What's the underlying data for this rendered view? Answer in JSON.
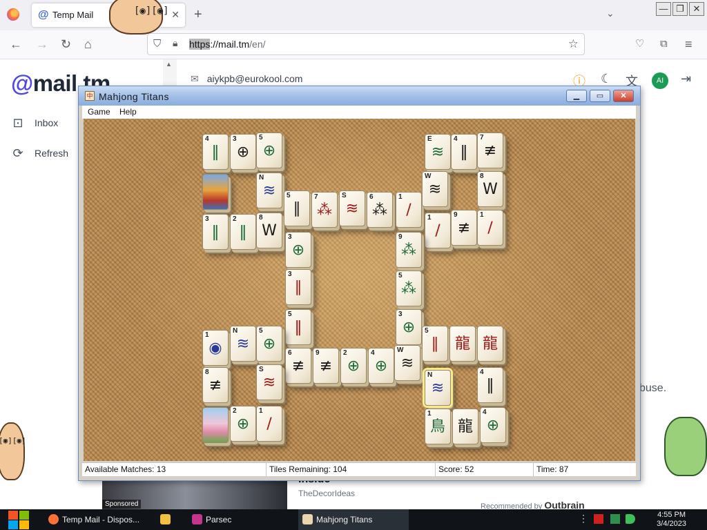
{
  "browser": {
    "tab_title": "Temp Mail",
    "url_scheme": "https",
    "url_host": "://mail.tm",
    "url_path": "/en/",
    "tab_icon": "at-sign-icon"
  },
  "mailtm": {
    "logo_at": "@",
    "logo_text": "mail.tm",
    "email": "aiykpb@eurokool.com",
    "avatar_initials": "AI",
    "sidebar": [
      {
        "label": "Inbox",
        "icon": "inbox-icon"
      },
      {
        "label": "Refresh",
        "icon": "refresh-icon"
      }
    ],
    "abuse_text": "buse.",
    "ad": {
      "sponsored": "Sponsored",
      "heading": "Inside",
      "source": "TheDecorIdeas",
      "recommended_by": "Recommended by",
      "brand": "Outbrain"
    }
  },
  "mahjong": {
    "title": "Mahjong Titans",
    "menu": [
      "Game",
      "Help"
    ],
    "status": {
      "matches": "Available Matches: 13",
      "remaining": "Tiles Remaining: 104",
      "score": "Score: 52",
      "time": "Time: 87"
    },
    "tiles": [
      {
        "label": "4",
        "glyph": "‖",
        "color": "#1d6b3a"
      },
      {
        "label": "3",
        "glyph": "⊕",
        "color": "#1b1b1b"
      },
      {
        "label": "5",
        "glyph": "⊕",
        "color": "#1d6b3a"
      },
      {
        "label": "",
        "glyph": "",
        "color": "#000",
        "picture": 1
      },
      {
        "label": "N",
        "glyph": "≋",
        "color": "#2a3a9a"
      },
      {
        "label": "3",
        "glyph": "‖",
        "color": "#1d6b3a"
      },
      {
        "label": "2",
        "glyph": "‖",
        "color": "#1d6b3a"
      },
      {
        "label": "8",
        "glyph": "W",
        "color": "#1b1b1b"
      },
      {
        "label": "5",
        "glyph": "∥",
        "color": "#1b1b1b"
      },
      {
        "label": "7",
        "glyph": "⁂",
        "color": "#a01818"
      },
      {
        "label": "S",
        "glyph": "≋",
        "color": "#a01818"
      },
      {
        "label": "6",
        "glyph": "⁂",
        "color": "#1b1b1b"
      },
      {
        "label": "1",
        "glyph": "/",
        "color": "#a01818"
      },
      {
        "label": "E",
        "glyph": "≋",
        "color": "#1d6b3a"
      },
      {
        "label": "4",
        "glyph": "‖",
        "color": "#1b1b1b"
      },
      {
        "label": "7",
        "glyph": "≢",
        "color": "#1b1b1b"
      },
      {
        "label": "W",
        "glyph": "≋",
        "color": "#1b1b1b"
      },
      {
        "label": "8",
        "glyph": "W",
        "color": "#1b1b1b"
      },
      {
        "label": "1",
        "glyph": "/",
        "color": "#a01818"
      },
      {
        "label": "9",
        "glyph": "≢",
        "color": "#1b1b1b"
      },
      {
        "label": "1",
        "glyph": "/",
        "color": "#a01818"
      },
      {
        "label": "3",
        "glyph": "⊕",
        "color": "#1d6b3a"
      },
      {
        "label": "9",
        "glyph": "⁂",
        "color": "#1d6b3a"
      },
      {
        "label": "3",
        "glyph": "∥",
        "color": "#a01818"
      },
      {
        "label": "5",
        "glyph": "⁂",
        "color": "#1d6b3a"
      },
      {
        "label": "3",
        "glyph": "⊕",
        "color": "#1d6b3a"
      },
      {
        "label": "5",
        "glyph": "‖",
        "color": "#a01818"
      },
      {
        "label": "1",
        "glyph": "◉",
        "color": "#2a3a9a"
      },
      {
        "label": "N",
        "glyph": "≋",
        "color": "#2a3a9a"
      },
      {
        "label": "5",
        "glyph": "⊕",
        "color": "#1d6b3a"
      },
      {
        "label": "6",
        "glyph": "≢",
        "color": "#1b1b1b"
      },
      {
        "label": "9",
        "glyph": "≢",
        "color": "#1b1b1b"
      },
      {
        "label": "2",
        "glyph": "⊕",
        "color": "#1d6b3a"
      },
      {
        "label": "4",
        "glyph": "⊕",
        "color": "#1d6b3a"
      },
      {
        "label": "W",
        "glyph": "≋",
        "color": "#1b1b1b"
      },
      {
        "label": "5",
        "glyph": "∥",
        "color": "#a01818"
      },
      {
        "label": "",
        "glyph": "龍",
        "color": "#a01818"
      },
      {
        "label": "",
        "glyph": "龍",
        "color": "#a01818"
      },
      {
        "label": "8",
        "glyph": "≢",
        "color": "#1b1b1b"
      },
      {
        "label": "S",
        "glyph": "≋",
        "color": "#a01818"
      },
      {
        "label": "N",
        "glyph": "≋",
        "color": "#2a3a9a",
        "highlight": 1
      },
      {
        "label": "4",
        "glyph": "‖",
        "color": "#1b1b1b"
      },
      {
        "label": "",
        "glyph": "",
        "color": "#000",
        "picture": 2
      },
      {
        "label": "2",
        "glyph": "⊕",
        "color": "#1d6b3a"
      },
      {
        "label": "1",
        "glyph": "/",
        "color": "#a01818"
      },
      {
        "label": "1",
        "glyph": "鳥",
        "color": "#1d6b3a"
      },
      {
        "label": "",
        "glyph": "龍",
        "color": "#1b1b1b"
      },
      {
        "label": "4",
        "glyph": "⊕",
        "color": "#1d6b3a"
      }
    ]
  },
  "taskbar": {
    "items": [
      {
        "label": "Temp Mail - Dispos...",
        "color": "#ff7139"
      },
      {
        "label": "",
        "color": "#f0c040"
      },
      {
        "label": "Parsec",
        "color": "#c2368c"
      },
      {
        "label": "Mahjong Titans",
        "color": "#e9d6ae"
      }
    ],
    "time": "4:55 PM",
    "date": "3/4/2023"
  }
}
